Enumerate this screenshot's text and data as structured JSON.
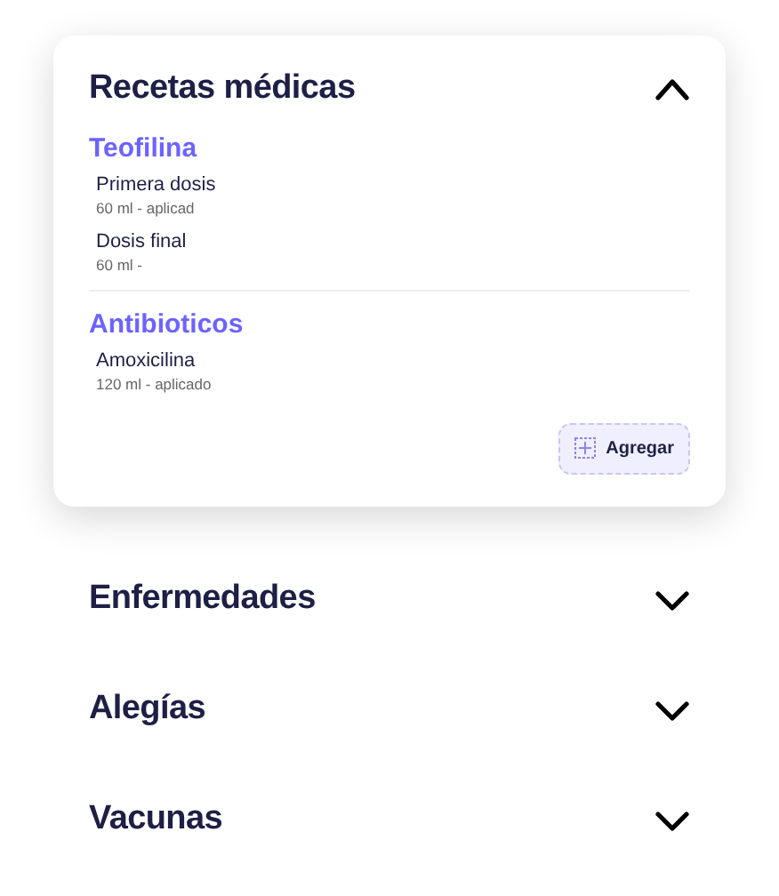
{
  "sections": [
    {
      "title": "Recetas médicas",
      "expanded": true,
      "groups": [
        {
          "name": "Teofilina",
          "items": [
            {
              "name": "Primera dosis",
              "detail": "60 ml - aplicad"
            },
            {
              "name": "Dosis final",
              "detail": "60 ml -"
            }
          ]
        },
        {
          "name": "Antibioticos",
          "items": [
            {
              "name": "Amoxicilina",
              "detail": "120 ml - aplicado"
            }
          ]
        }
      ],
      "add_button": "Agregar"
    },
    {
      "title": "Enfermedades",
      "expanded": false
    },
    {
      "title": "Alegías",
      "expanded": false
    },
    {
      "title": "Vacunas",
      "expanded": false
    }
  ]
}
